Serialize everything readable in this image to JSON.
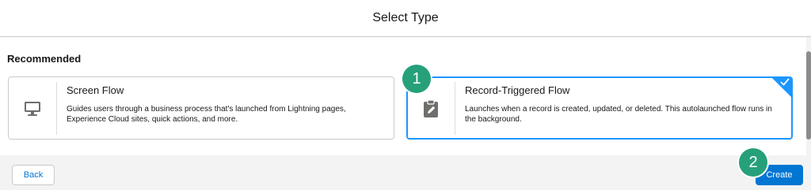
{
  "header": {
    "title": "Select Type"
  },
  "body": {
    "section_title": "Recommended",
    "cards": [
      {
        "name": "Screen Flow",
        "description": "Guides users through a business process that's launched from Lightning pages, Experience Cloud sites, quick actions, and more.",
        "icon": "desktop-icon",
        "selected": false
      },
      {
        "name": "Record-Triggered Flow",
        "description": "Launches when a record is created, updated, or deleted. This autolaunched flow runs in the background.",
        "icon": "clipboard-edit-icon",
        "selected": true
      }
    ]
  },
  "footer": {
    "back_label": "Back",
    "create_label": "Create"
  },
  "annotations": {
    "step1": "1",
    "step2": "2"
  },
  "colors": {
    "brand_blue": "#0176d3",
    "selection_blue": "#1b96ff",
    "badge_green": "#26a07a",
    "icon_gray": "#706e6b"
  }
}
